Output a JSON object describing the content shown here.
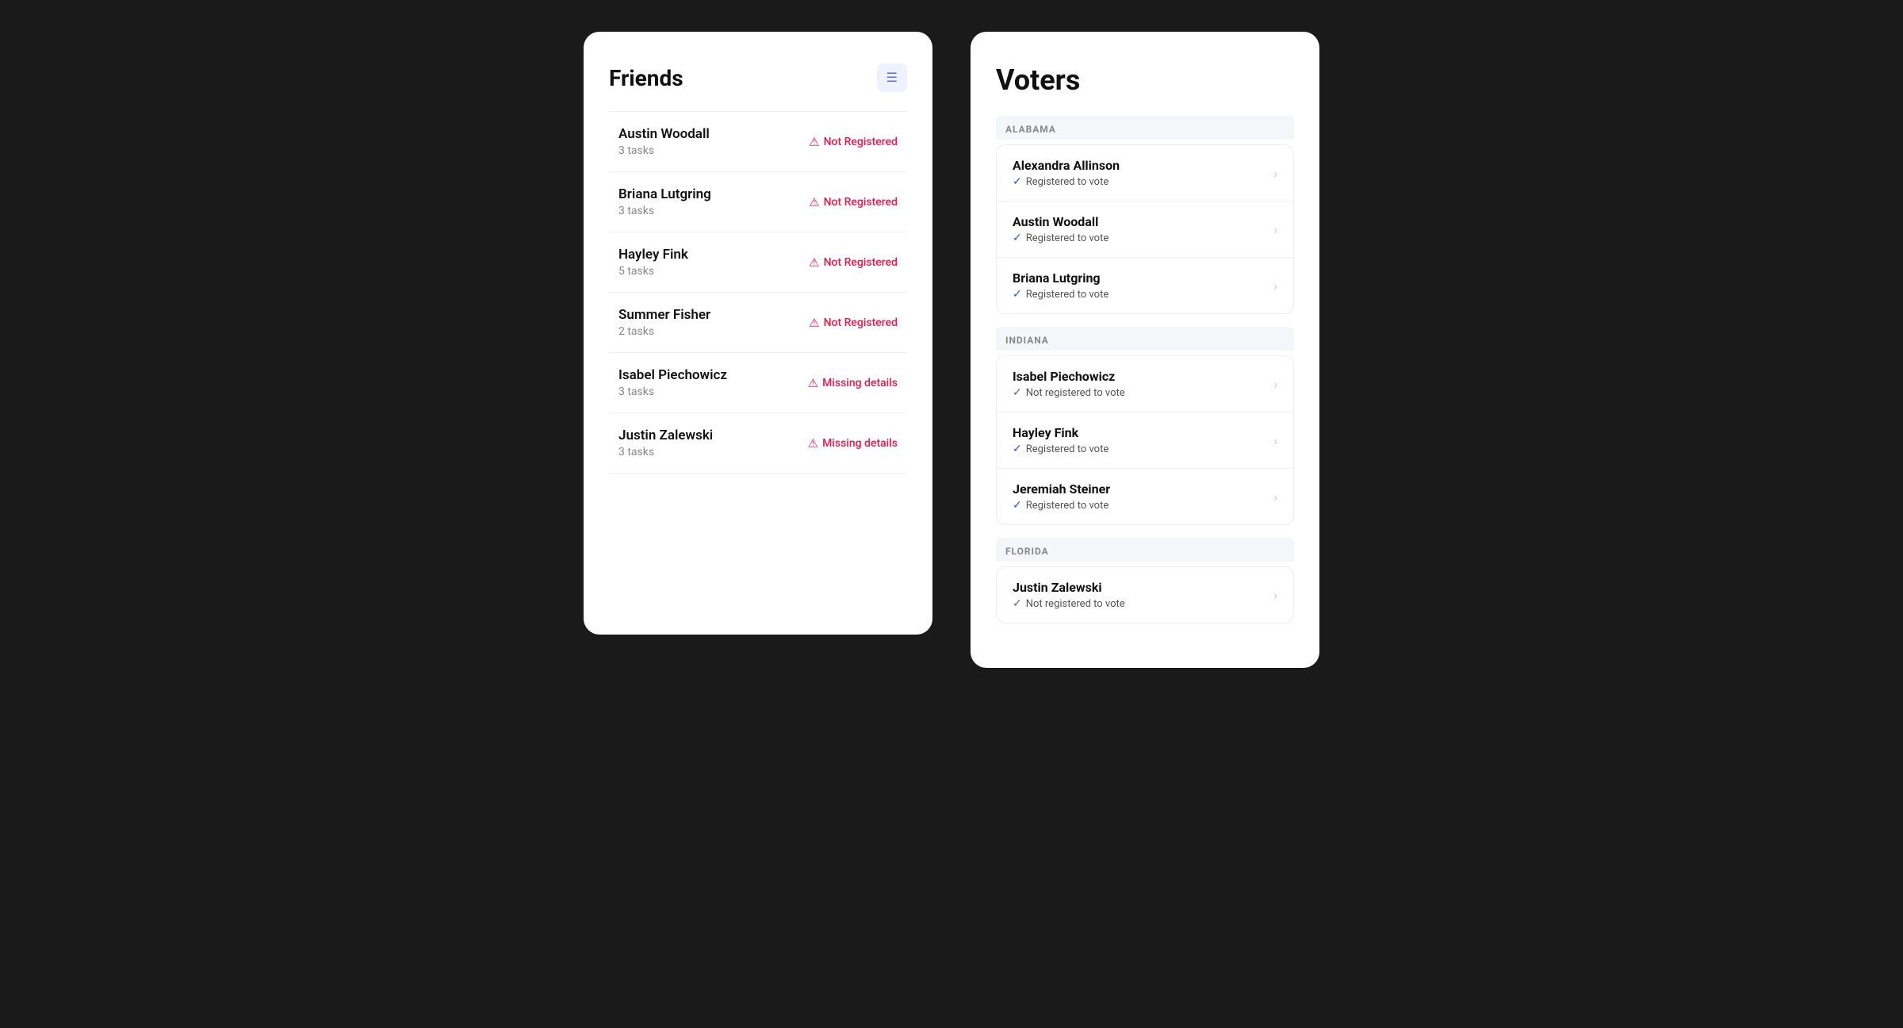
{
  "friends_card": {
    "title": "Friends",
    "filter_label": "filter",
    "friends": [
      {
        "name": "Austin Woodall",
        "tasks": "3 tasks",
        "status": "Not Registered",
        "status_type": "not_registered"
      },
      {
        "name": "Briana Lutgring",
        "tasks": "3 tasks",
        "status": "Not Registered",
        "status_type": "not_registered"
      },
      {
        "name": "Hayley Fink",
        "tasks": "5 tasks",
        "status": "Not Registered",
        "status_type": "not_registered"
      },
      {
        "name": "Summer Fisher",
        "tasks": "2 tasks",
        "status": "Not Registered",
        "status_type": "not_registered"
      },
      {
        "name": "Isabel Piechowicz",
        "tasks": "3 tasks",
        "status": "Missing details",
        "status_type": "missing_details"
      },
      {
        "name": "Justin Zalewski",
        "tasks": "3 tasks",
        "status": "Missing details",
        "status_type": "missing_details"
      }
    ]
  },
  "voters_card": {
    "title": "Voters",
    "sections": [
      {
        "state": "ALABAMA",
        "voters": [
          {
            "name": "Alexandra Allinson",
            "reg_status": "Registered to vote",
            "registered": true
          },
          {
            "name": "Austin Woodall",
            "reg_status": "Registered to vote",
            "registered": true
          },
          {
            "name": "Briana Lutgring",
            "reg_status": "Registered to vote",
            "registered": true
          }
        ]
      },
      {
        "state": "INDIANA",
        "voters": [
          {
            "name": "Isabel Piechowicz",
            "reg_status": "Not registered to vote",
            "registered": false
          },
          {
            "name": "Hayley Fink",
            "reg_status": "Registered to vote",
            "registered": true
          },
          {
            "name": "Jeremiah Steiner",
            "reg_status": "Registered to vote",
            "registered": true
          }
        ]
      },
      {
        "state": "FLORIDA",
        "voters": [
          {
            "name": "Justin Zalewski",
            "reg_status": "Not registered to vote",
            "registered": false
          }
        ]
      }
    ]
  }
}
